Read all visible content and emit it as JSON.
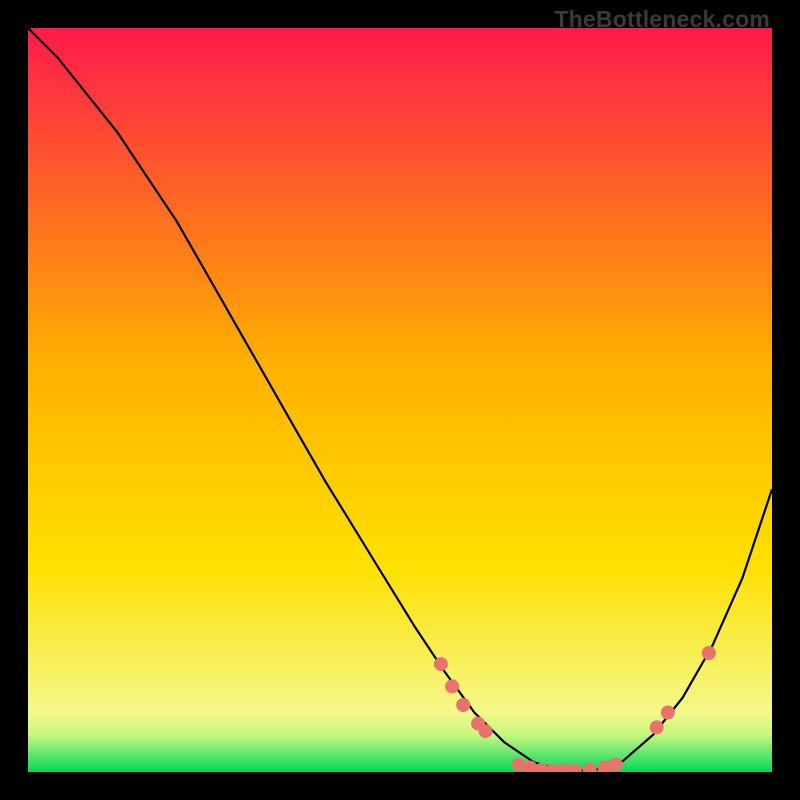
{
  "watermark": "TheBottleneck.com",
  "chart_data": {
    "type": "line",
    "title": "",
    "xlabel": "",
    "ylabel": "",
    "xlim": [
      0,
      100
    ],
    "ylim": [
      0,
      100
    ],
    "grid": false,
    "legend": false,
    "background_gradient": {
      "top_color": "#ff1a4b",
      "mid_color": "#ffe000",
      "bottom_color": "#00e060",
      "green_band_start_pct": 94
    },
    "series": [
      {
        "name": "bottleneck-curve",
        "x": [
          0,
          4,
          8,
          12,
          16,
          20,
          24,
          28,
          32,
          36,
          40,
          44,
          48,
          52,
          56,
          60,
          64,
          68,
          72,
          76,
          80,
          84,
          88,
          92,
          96,
          100
        ],
        "y": [
          100,
          96,
          91,
          86,
          80,
          74,
          67,
          60,
          53,
          46,
          39,
          32.5,
          26,
          19.5,
          13.5,
          8,
          4,
          1.3,
          0.2,
          0.2,
          1.5,
          5,
          10,
          17,
          26,
          38
        ],
        "stroke": "#000000",
        "stroke_width": 2.2
      }
    ],
    "scatter_points": {
      "name": "marked-points",
      "color": "#e9726c",
      "radius": 7,
      "points": [
        {
          "x": 55.5,
          "y": 14.5
        },
        {
          "x": 57.0,
          "y": 11.5
        },
        {
          "x": 58.5,
          "y": 9.0
        },
        {
          "x": 60.5,
          "y": 6.5
        },
        {
          "x": 61.5,
          "y": 5.5
        },
        {
          "x": 66.0,
          "y": 1.0
        },
        {
          "x": 67.5,
          "y": 0.6
        },
        {
          "x": 69.0,
          "y": 0.3
        },
        {
          "x": 70.5,
          "y": 0.2
        },
        {
          "x": 72.0,
          "y": 0.2
        },
        {
          "x": 73.5,
          "y": 0.2
        },
        {
          "x": 75.5,
          "y": 0.3
        },
        {
          "x": 77.5,
          "y": 0.6
        },
        {
          "x": 79.0,
          "y": 1.0
        },
        {
          "x": 84.5,
          "y": 6.0
        },
        {
          "x": 86.0,
          "y": 8.0
        },
        {
          "x": 91.5,
          "y": 16.0
        }
      ]
    }
  }
}
